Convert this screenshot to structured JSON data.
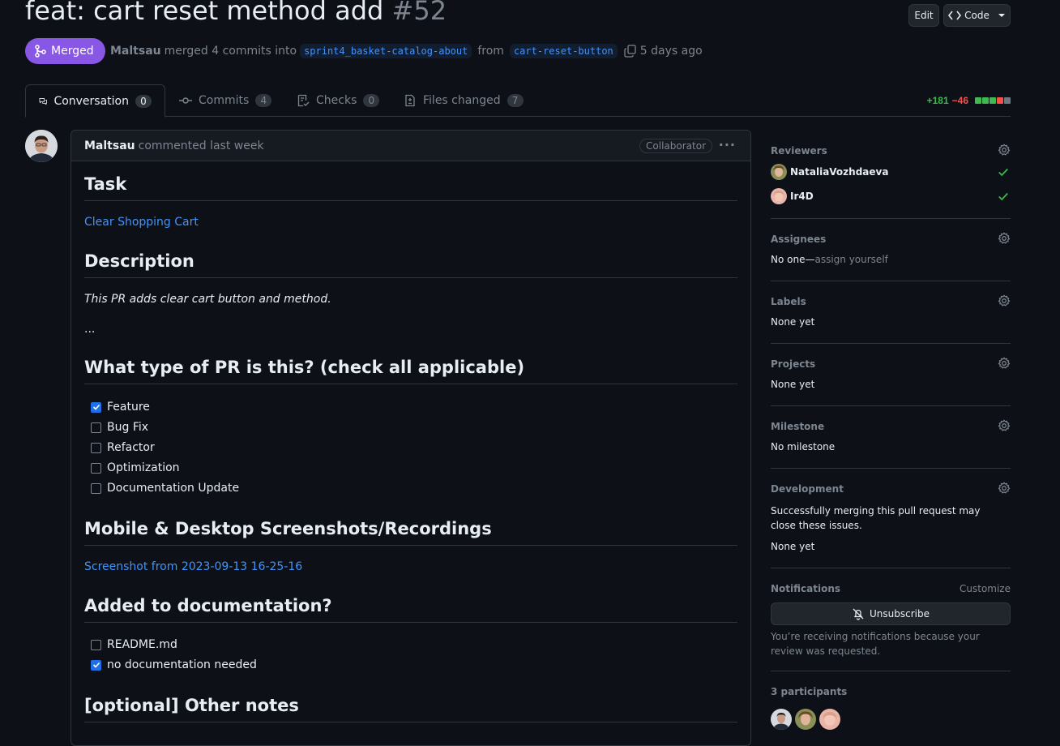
{
  "header": {
    "title": "feat: cart reset method add",
    "number": "#52",
    "edit_label": "Edit",
    "code_label": "Code",
    "status": "Merged",
    "author": "Maltsau",
    "merged_text": "merged 4 commits into",
    "base_branch": "sprint4_basket-catalog-about",
    "from_text": "from",
    "head_branch": "cart-reset-button",
    "time_ago": "5 days ago"
  },
  "tabs": [
    {
      "label": "Conversation",
      "count": "0"
    },
    {
      "label": "Commits",
      "count": "4"
    },
    {
      "label": "Checks",
      "count": "0"
    },
    {
      "label": "Files changed",
      "count": "7"
    }
  ],
  "diffstat": {
    "additions": "+181",
    "deletions": "−46",
    "blocks": [
      "#3fb950",
      "#3fb950",
      "#3fb950",
      "#f85149",
      "#6e7681"
    ]
  },
  "comment": {
    "author": "Maltsau",
    "action": "commented last week",
    "role": "Collaborator",
    "task_heading": "Task",
    "task_link": "Clear Shopping Cart",
    "description_heading": "Description",
    "description_text": "This PR adds clear cart button and method.",
    "ellipsis": "...",
    "type_heading": "What type of PR is this? (check all applicable)",
    "type_items": [
      {
        "label": "Feature",
        "checked": true
      },
      {
        "label": "Bug Fix",
        "checked": false
      },
      {
        "label": "Refactor",
        "checked": false
      },
      {
        "label": "Optimization",
        "checked": false
      },
      {
        "label": "Documentation Update",
        "checked": false
      }
    ],
    "screenshots_heading": "Mobile & Desktop Screenshots/Recordings",
    "screenshot_link": "Screenshot from 2023-09-13 16-25-16",
    "docs_heading": "Added to documentation?",
    "docs_items": [
      {
        "label": "README.md",
        "checked": false
      },
      {
        "label": "no documentation needed",
        "checked": true
      }
    ],
    "notes_heading": "[optional] Other notes"
  },
  "sidebar": {
    "reviewers_title": "Reviewers",
    "reviewers": [
      "NataliaVozhdaeva",
      "Ir4D"
    ],
    "assignees_title": "Assignees",
    "assignees_none": "No one—",
    "assignees_action": "assign yourself",
    "labels_title": "Labels",
    "labels_value": "None yet",
    "projects_title": "Projects",
    "projects_value": "None yet",
    "milestone_title": "Milestone",
    "milestone_value": "No milestone",
    "development_title": "Development",
    "development_text": "Successfully merging this pull request may close these issues.",
    "development_value": "None yet",
    "notifications_title": "Notifications",
    "customize_label": "Customize",
    "unsubscribe_label": "Unsubscribe",
    "notifications_note": "You’re receiving notifications because your review was requested.",
    "participants_title": "3 participants"
  },
  "colors": {
    "merged": "#8957e5",
    "link": "#4493f8",
    "success": "#3fb950",
    "danger": "#f85149"
  }
}
